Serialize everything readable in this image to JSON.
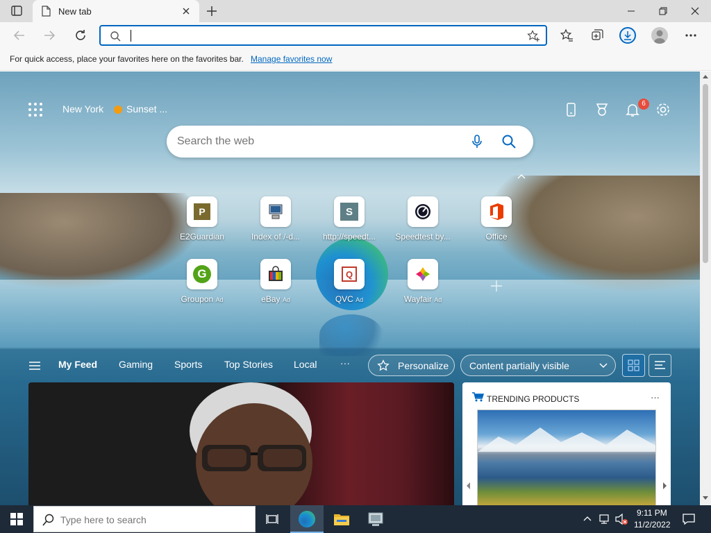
{
  "window": {
    "tab_title": "New tab"
  },
  "address_bar": {
    "value": "",
    "placeholder": ""
  },
  "favorites_bar": {
    "message": "For quick access, place your favorites here on the favorites bar.",
    "link": "Manage favorites now"
  },
  "ntp": {
    "location": "New York",
    "weather": "Sunset ...",
    "notification_count": "6",
    "search_placeholder": "Search the web",
    "quick_links": [
      {
        "label": "E2Guardian",
        "glyph": "P",
        "bg": "#7a6a2e",
        "fg": "#ffffff"
      },
      {
        "label": "Index of /-d...",
        "glyph": "",
        "bg": "",
        "fg": ""
      },
      {
        "label": "http://speedt...",
        "glyph": "S",
        "bg": "#5f7f86",
        "fg": "#ffffff"
      },
      {
        "label": "Speedtest by...",
        "glyph": "",
        "bg": "",
        "fg": ""
      },
      {
        "label": "Office",
        "glyph": "",
        "bg": "",
        "fg": ""
      },
      {
        "label": "Groupon",
        "ad": "Ad",
        "glyph": "G",
        "bg": "#ffffff",
        "fg": "#53a318"
      },
      {
        "label": "eBay",
        "ad": "Ad",
        "glyph": "",
        "bg": "",
        "fg": ""
      },
      {
        "label": "QVC",
        "ad": "Ad",
        "glyph": "Q",
        "bg": "#ffffff",
        "fg": "#c0392b"
      },
      {
        "label": "Wayfair",
        "ad": "Ad",
        "glyph": "",
        "bg": "",
        "fg": ""
      }
    ]
  },
  "feed": {
    "tabs": [
      "My Feed",
      "Gaming",
      "Sports",
      "Top Stories",
      "Local"
    ],
    "more": "···",
    "personalize": "Personalize",
    "content_select": "Content partially visible",
    "trending_title": "TRENDING PRODUCTS",
    "trending_more": "···"
  },
  "taskbar": {
    "search_placeholder": "Type here to search",
    "time": "9:11 PM",
    "date": "11/2/2022"
  },
  "colors": {
    "accent": "#0067c0",
    "taskbar": "#1e2a38",
    "badge": "#e74c3c"
  }
}
